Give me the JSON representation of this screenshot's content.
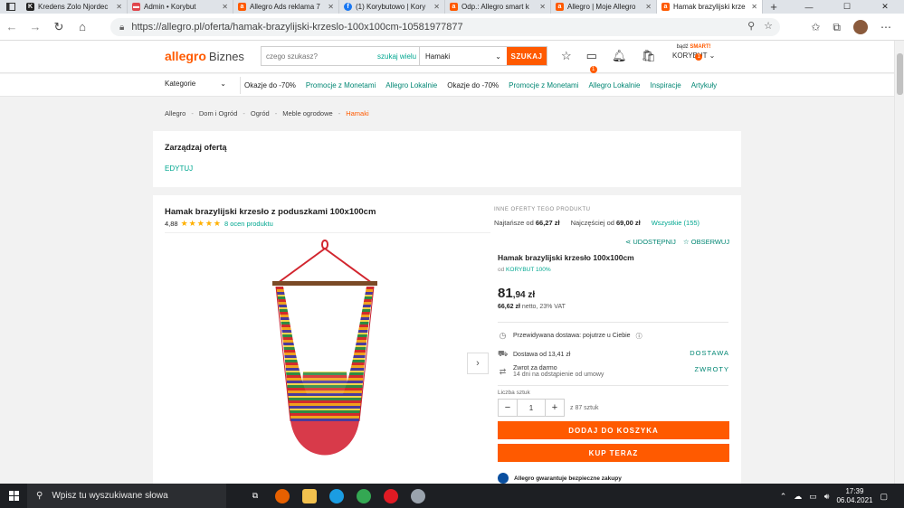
{
  "browser": {
    "tabs": [
      {
        "title": "Kredens Zolo Njordec",
        "favicon": "K",
        "color": "#222222"
      },
      {
        "title": "Admin • Korybut",
        "favicon": "cart",
        "color": "#e0464c"
      },
      {
        "title": "Allegro Ads reklama 7",
        "favicon": "a",
        "color": "#ff5a00"
      },
      {
        "title": "(1) Korybutowo | Kory",
        "favicon": "f",
        "color": "#1877f2"
      },
      {
        "title": "Odp.: Allegro smart k",
        "favicon": "a",
        "color": "#ff5a00"
      },
      {
        "title": "Allegro | Moje Allegro",
        "favicon": "a",
        "color": "#ff5a00"
      },
      {
        "title": "Hamak brazylijski krze",
        "favicon": "a",
        "color": "#ff5a00"
      }
    ],
    "url": "https://allegro.pl/oferta/hamak-brazylijski-krzeslo-100x100cm-10581977877"
  },
  "header": {
    "logo": "allegro",
    "logo_suffix": "Biznes",
    "search_placeholder": "czego szukasz?",
    "search_many": "szukaj wielu",
    "search_category": "Hamaki",
    "search_button": "SZUKAJ",
    "messages_badge": "1",
    "smart_prefix": "bądź",
    "smart_word": "SMART!",
    "account_name": "KORYBUT",
    "account_badge": "1"
  },
  "nav": {
    "categories": "Kategorie",
    "links": [
      "Okazje do -70%",
      "Promocje z Monetami",
      "Allegro Lokalnie",
      "Okazje do -70%",
      "Promocje z Monetami",
      "Allegro Lokalnie",
      "Inspiracje",
      "Artykuły"
    ]
  },
  "breadcrumb": [
    "Allegro",
    "Dom i Ogród",
    "Ogród",
    "Meble ogrodowe",
    "Hamaki"
  ],
  "manage": {
    "title": "Zarządzaj ofertą",
    "edit": "EDYTUJ"
  },
  "product": {
    "title": "Hamak brazylijski krzesło z poduszkami 100x100cm",
    "rating": "4,88",
    "rating_stars": 5,
    "rating_count": "8 ocen produktu",
    "other_offers_label": "INNE OFERTY TEGO PRODUKTU",
    "cheapest_label": "Najtańsze od",
    "cheapest_price": "66,27 zł",
    "popular_label": "Najczęściej od",
    "popular_price": "69,00 zł",
    "all_offers": "Wszystkie (155)",
    "share": "UDOSTĘPNIJ",
    "follow": "OBSERWUJ",
    "buybox_title": "Hamak brazylijski krzesło 100x100cm",
    "seller_prefix": "od",
    "seller_name": "KORYBUT",
    "seller_rating": "100%",
    "price_main": "81",
    "price_fraction": ",94 zł",
    "netto_value": "66,62 zł",
    "netto_label": "netto, 23% VAT",
    "delivery_forecast": "Przewidywana dostawa: pojutrze u Ciebie",
    "delivery_cost": "Dostawa od 13,41 zł",
    "delivery_link": "DOSTAWA",
    "return_title": "Zwrot za darmo",
    "return_sub": "14 dni na odstąpienie od umowy",
    "return_link": "ZWROTY",
    "qty_label": "Liczba sztuk",
    "qty_value": "1",
    "qty_stock": "z 87 sztuk",
    "add_to_cart": "DODAJ DO KOSZYKA",
    "buy_now": "KUP TERAZ",
    "guarantee": "Allegro gwarantuje bezpieczne zakupy"
  },
  "taskbar": {
    "search_placeholder": "Wpisz tu wyszukiwane słowa",
    "time": "17:39",
    "date": "06.04.2021"
  }
}
